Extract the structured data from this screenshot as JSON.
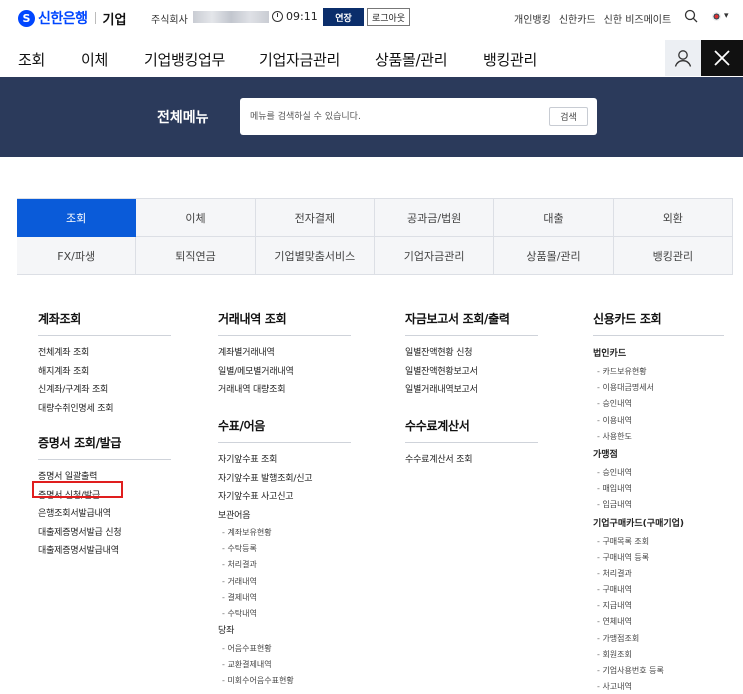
{
  "topbar": {
    "logo_mark": "S",
    "logo_name": "신한은행",
    "logo_sub": "기업",
    "company": "주식회사",
    "timer": "09:11",
    "extend_label": "연장",
    "logout_label": "로그아웃",
    "links": [
      "개인뱅킹",
      "신한카드",
      "신한 비즈메이트"
    ],
    "lang": "▾"
  },
  "gnb": {
    "items": [
      "조회",
      "이체",
      "기업뱅킹업무",
      "기업자금관리",
      "상품몰/관리",
      "뱅킹관리"
    ]
  },
  "band": {
    "title": "전체메뉴",
    "search_placeholder": "메뉴를 검색하실 수 있습니다.",
    "search_button": "검색"
  },
  "tabs": {
    "row1": [
      "조회",
      "이체",
      "전자결제",
      "공과금/법원",
      "대출",
      "외환"
    ],
    "row2": [
      "FX/파생",
      "퇴직연금",
      "기업별맞춤서비스",
      "기업자금관리",
      "상품몰/관리",
      "뱅킹관리"
    ],
    "active_index": 0
  },
  "col1": {
    "title1": "계좌조회",
    "links1": [
      "전체계좌 조회",
      "해지계좌 조회",
      "신계좌/구계좌 조회",
      "대량수취인명세 조회"
    ],
    "title2": "증명서 조회/발급",
    "links2": [
      "증명서 일괄출력",
      "증명서 신청/발급",
      "은행조회서발급내역",
      "대출제증명서발급 신청",
      "대출제증명서발급내역"
    ]
  },
  "col2": {
    "title1": "거래내역 조회",
    "links1": [
      "계좌별거래내역",
      "일별/메모별거래내역",
      "거래내역 대량조회"
    ],
    "title2": "수표/어음",
    "links2": [
      "자기앞수표 조회",
      "자기앞수표 발행조회/신고",
      "자기앞수표 사고신고"
    ],
    "group1": "보관어음",
    "subs1": [
      "계좌보유현황",
      "수탁등록",
      "처리결과",
      "거래내역",
      "결제내역",
      "수탁내역"
    ],
    "group2": "당좌",
    "subs2": [
      "어음수표현황",
      "교환결제내역",
      "미회수어음수표현황"
    ]
  },
  "col3": {
    "title1": "자금보고서 조회/출력",
    "links1": [
      "일별잔액현황 신청",
      "일별잔액현황보고서",
      "일별거래내역보고서"
    ],
    "title2": "수수료계산서",
    "links2": [
      "수수료계산서 조회"
    ]
  },
  "col4": {
    "title": "신용카드 조회",
    "group1": "법인카드",
    "subs1": [
      "카드보유현황",
      "이용대금명세서",
      "승인내역",
      "이용내역",
      "사용한도"
    ],
    "group2": "가맹점",
    "subs2": [
      "승인내역",
      "매입내역",
      "입금내역"
    ],
    "group3": "기업구매카드(구매기업)",
    "subs3": [
      "구매목록 조회",
      "구매내역 등록",
      "처리결과",
      "구매내역",
      "지급내역",
      "연체내역",
      "가맹점조회",
      "회원조회",
      "기업사용번호 등록",
      "사고내역"
    ]
  }
}
